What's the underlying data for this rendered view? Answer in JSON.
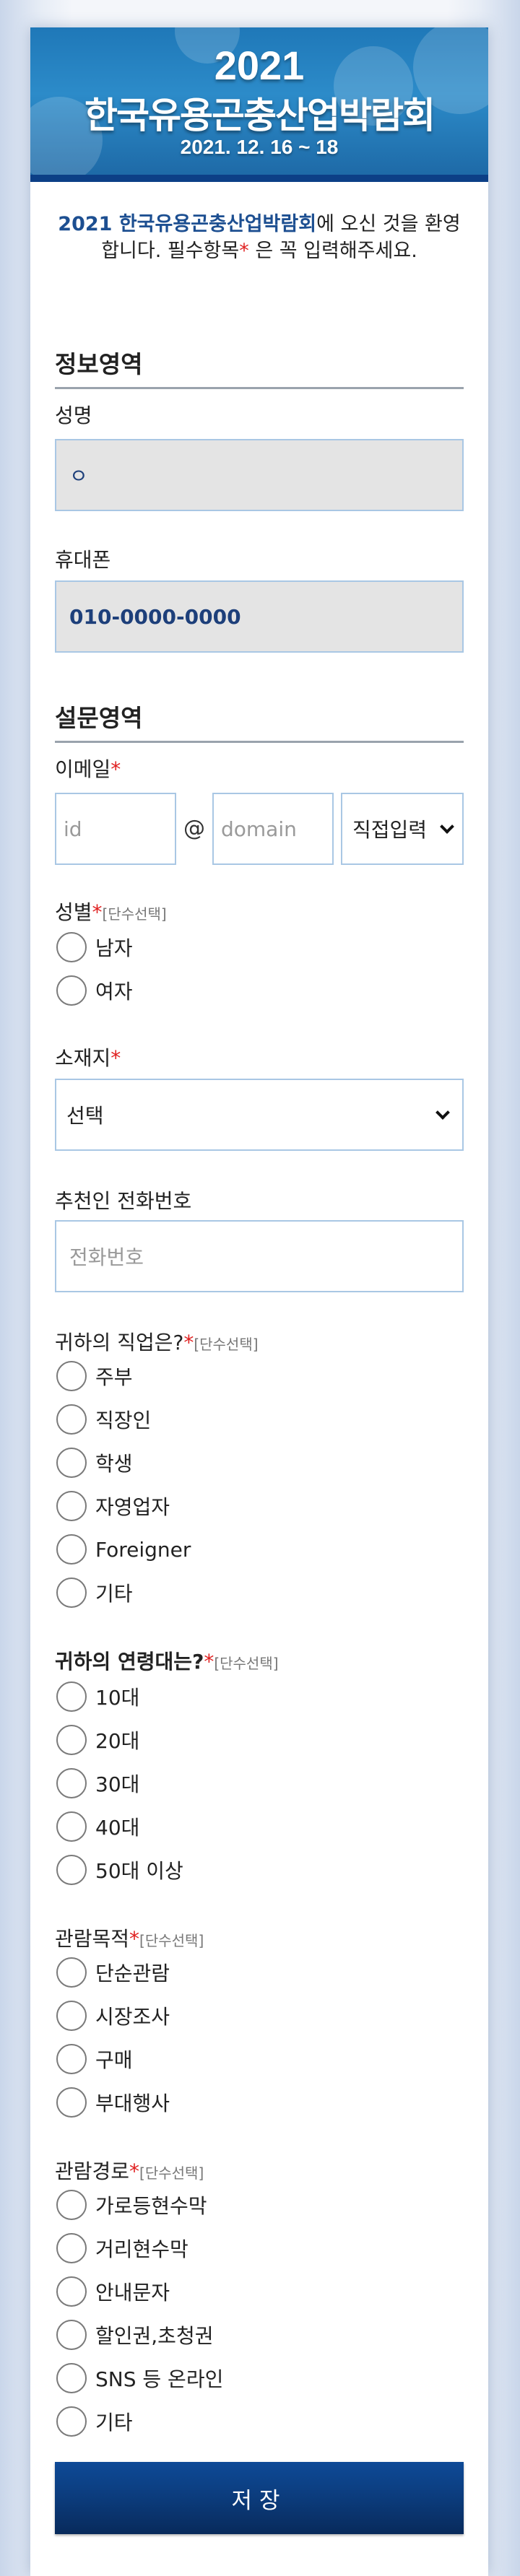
{
  "banner": {
    "year": "2021",
    "title": "한국유용곤충산업박람회",
    "date": "2021. 12. 16 ~ 18"
  },
  "welcome": {
    "highlight": "2021 한국유용곤충산업박람회",
    "text1": "에 오신 것을 환영합니다. 필수항목",
    "asterisk": "*",
    "text2": " 은 꼭 입력해주세요."
  },
  "info_section": {
    "title": "정보영역",
    "name_label": "성명",
    "name_value": "ㅇ",
    "phone_label": "휴대폰",
    "phone_value": "010-0000-0000"
  },
  "survey_section": {
    "title": "설문영역",
    "email": {
      "label": "이메일",
      "id_placeholder": "id",
      "at": "@",
      "domain_placeholder": "domain",
      "select_value": "직접입력"
    },
    "gender": {
      "label": "성별",
      "hint": "[단수선택]",
      "options": [
        "남자",
        "여자"
      ]
    },
    "location": {
      "label": "소재지",
      "select_value": "선택"
    },
    "referrer": {
      "label": "추천인 전화번호",
      "placeholder": "전화번호"
    },
    "job": {
      "label": "귀하의 직업은?",
      "hint": "[단수선택]",
      "options": [
        "주부",
        "직장인",
        "학생",
        "자영업자",
        "Foreigner",
        "기타"
      ]
    },
    "age": {
      "label": "귀하의 연령대는?",
      "hint": "[단수선택]",
      "options": [
        "10대",
        "20대",
        "30대",
        "40대",
        "50대 이상"
      ]
    },
    "purpose": {
      "label": "관람목적",
      "hint": "[단수선택]",
      "options": [
        "단순관람",
        "시장조사",
        "구매",
        "부대행사"
      ]
    },
    "route": {
      "label": "관람경로",
      "hint": "[단수선택]",
      "options": [
        "가로등현수막",
        "거리현수막",
        "안내문자",
        "할인권,초청권",
        "SNS 등 온라인",
        "기타"
      ]
    }
  },
  "save_label": "저장",
  "colors": {
    "brand_navy": "#0b3a79",
    "required": "#e02020",
    "field_border": "#a9c7e4"
  }
}
